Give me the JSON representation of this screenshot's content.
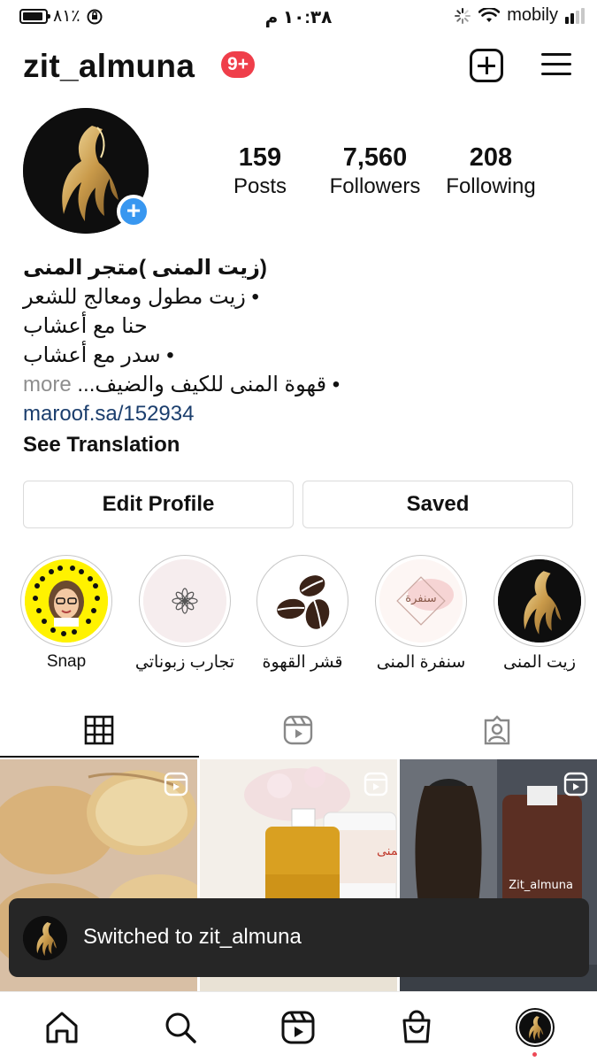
{
  "status_bar": {
    "battery": "٨١٪",
    "time": "١٠:٣٨ م",
    "carrier": "mobily"
  },
  "header": {
    "username": "zit_almuna",
    "notification_badge": "9+"
  },
  "profile": {
    "stats": [
      {
        "value": "159",
        "label": "Posts"
      },
      {
        "value": "7,560",
        "label": "Followers"
      },
      {
        "value": "208",
        "label": "Following"
      }
    ],
    "bio": {
      "name": "(زيت المنى )متجر المنى",
      "lines": [
        "• زيت مطول ومعالج للشعر",
        "حنا مع أعشاب",
        "• سدر مع أعشاب",
        "• قهوة المنى للكيف والضيف..."
      ],
      "more": "more",
      "link": "maroof.sa/152934",
      "see_translation": "See Translation"
    }
  },
  "buttons": {
    "edit_profile": "Edit Profile",
    "saved": "Saved"
  },
  "highlights": [
    {
      "label": "Snap"
    },
    {
      "label": "تجارب زبوناتي"
    },
    {
      "label": "قشر القهوة"
    },
    {
      "label": "سنفرة المنى",
      "image_text": "سنفرة"
    },
    {
      "label": "زيت المنى"
    }
  ],
  "posts": [
    {
      "overlay_text": ""
    },
    {
      "overlay_text": "سدر المنى"
    },
    {
      "overlay_text": "Zit_almuna"
    }
  ],
  "toast": {
    "message": "Switched to zit_almuna"
  },
  "bottom_nav": [
    "home-icon",
    "search-icon",
    "reels-icon",
    "shop-icon",
    "profile-avatar"
  ],
  "colors": {
    "badge": "#ef3e4a",
    "accent": "#3897f0",
    "link": "#1b3e6d",
    "toast_bg": "#262626"
  }
}
